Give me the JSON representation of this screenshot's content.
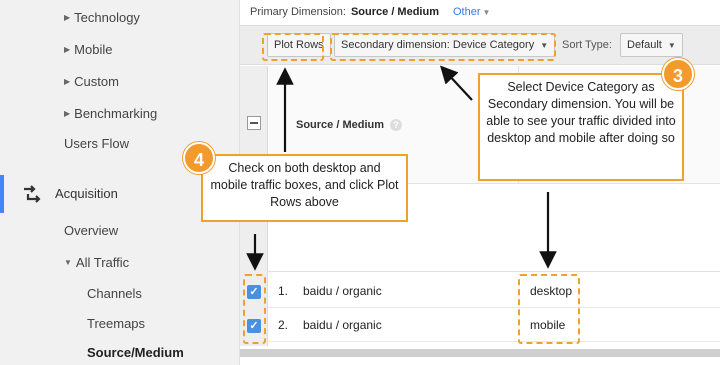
{
  "sidebar": {
    "items": [
      {
        "label": "Technology",
        "expandable": true
      },
      {
        "label": "Mobile",
        "expandable": true
      },
      {
        "label": "Custom",
        "expandable": true
      },
      {
        "label": "Benchmarking",
        "expandable": true
      },
      {
        "label": "Users Flow",
        "expandable": false
      }
    ],
    "acquisition": "Acquisition",
    "sub_items": [
      {
        "label": "Overview"
      },
      {
        "label": "All Traffic",
        "expanded": true
      },
      {
        "label": "Channels"
      },
      {
        "label": "Treemaps"
      },
      {
        "label": "Source/Medium",
        "active": true
      }
    ],
    "accent_color": "#4285f4"
  },
  "toolbar": {
    "primary_dimension_label": "Primary Dimension:",
    "primary_dimension_value": "Source / Medium",
    "other_label": "Other",
    "plot_rows_label": "Plot Rows",
    "secondary_dimension_label": "Secondary dimension: Device Category",
    "sort_type_label": "Sort Type:",
    "sort_type_value": "Default"
  },
  "table": {
    "column_header": "Source / Medium",
    "rows": [
      {
        "num": "1.",
        "source": "baidu / organic",
        "device": "desktop",
        "checked": true
      },
      {
        "num": "2.",
        "source": "baidu / organic",
        "device": "mobile",
        "checked": true
      }
    ]
  },
  "callouts": {
    "step3_number": "3",
    "step3_text": "Select Device Category as Secondary dimension. You will be able to see your traffic divided into desktop and mobile after doing so",
    "step4_number": "4",
    "step4_text": "Check on both desktop and mobile traffic boxes, and click Plot Rows above",
    "highlight_color": "#f0a030"
  }
}
